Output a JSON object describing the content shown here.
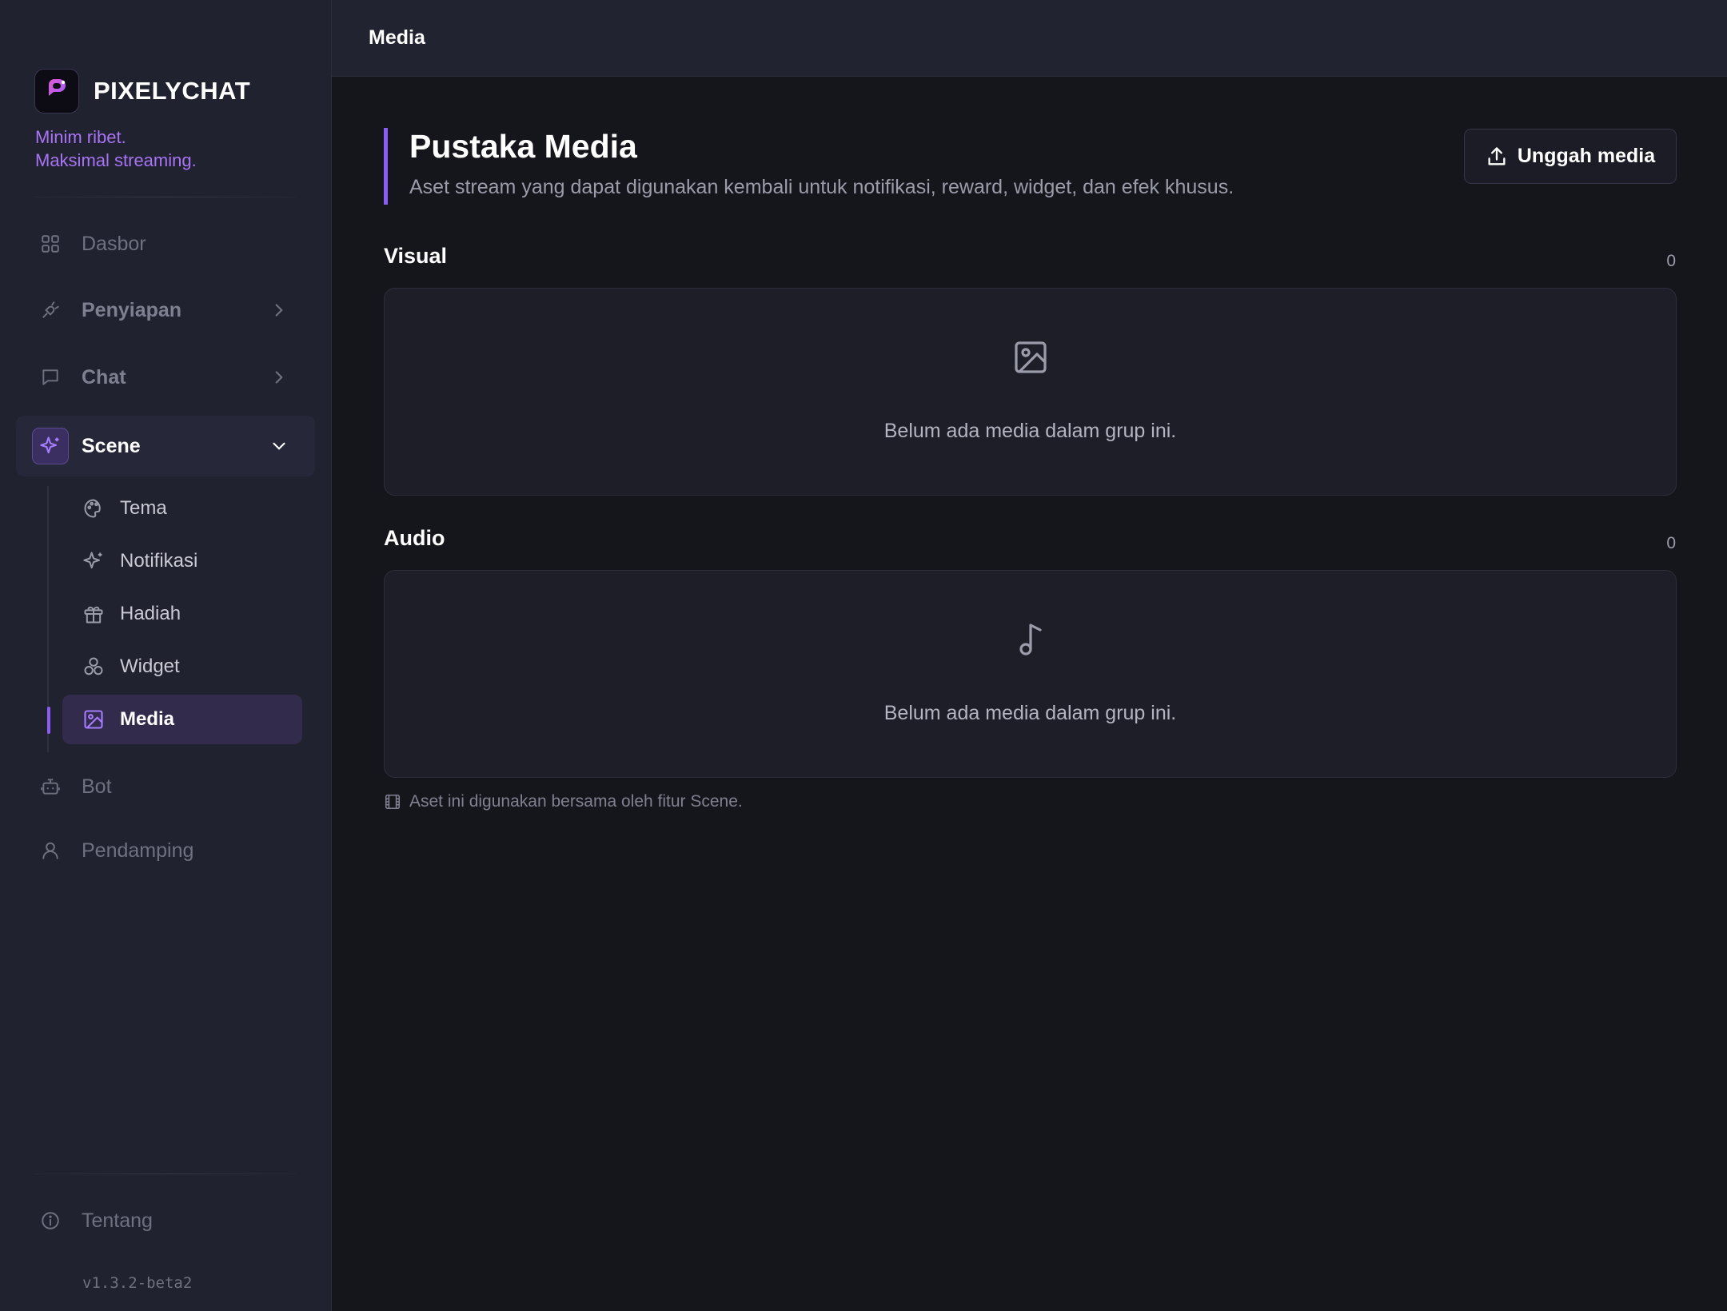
{
  "brand": {
    "name": "PIXELYCHAT",
    "tagline_line1": "Minim ribet.",
    "tagline_line2": "Maksimal streaming."
  },
  "sidebar": {
    "items": [
      {
        "label": "Dasbor",
        "icon": "grid-icon"
      },
      {
        "label": "Penyiapan",
        "icon": "plug-icon",
        "expandable": true
      },
      {
        "label": "Chat",
        "icon": "chat-bubble-icon",
        "expandable": true
      },
      {
        "label": "Scene",
        "icon": "sparkles-icon",
        "expanded": true,
        "active": true
      },
      {
        "label": "Bot",
        "icon": "bot-icon"
      },
      {
        "label": "Pendamping",
        "icon": "user-icon"
      }
    ],
    "scene_subitems": [
      {
        "label": "Tema",
        "icon": "palette-icon"
      },
      {
        "label": "Notifikasi",
        "icon": "sparkles-icon"
      },
      {
        "label": "Hadiah",
        "icon": "gift-icon"
      },
      {
        "label": "Widget",
        "icon": "shapes-icon"
      },
      {
        "label": "Media",
        "icon": "image-icon",
        "active": true
      }
    ],
    "about_label": "Tentang",
    "version": "v1.3.2-beta2"
  },
  "topbar": {
    "title": "Media"
  },
  "page": {
    "title": "Pustaka Media",
    "subtitle": "Aset stream yang dapat digunakan kembali untuk notifikasi, reward, widget, dan efek khusus.",
    "upload_label": "Unggah media"
  },
  "groups": [
    {
      "title": "Visual",
      "count": "0",
      "empty_message": "Belum ada media dalam grup ini.",
      "icon": "image-icon"
    },
    {
      "title": "Audio",
      "count": "0",
      "empty_message": "Belum ada media dalam grup ini.",
      "icon": "music-note-icon"
    }
  ],
  "footnote": "Aset ini digunakan bersama oleh fitur Scene.",
  "colors": {
    "accent": "#8b5cf6",
    "tagline": "#a874f5",
    "sidebar_bg": "#212230",
    "main_bg": "#15161b"
  }
}
